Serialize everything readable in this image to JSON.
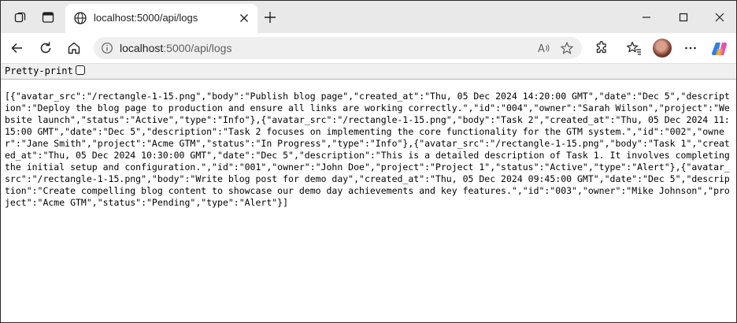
{
  "tab": {
    "title": "localhost:5000/api/logs"
  },
  "omnibox": {
    "host": "localhost",
    "path": ":5000/api/logs"
  },
  "icons": {
    "workspaces": "workspaces-icon",
    "tab_actions": "tab-actions-icon",
    "favicon": "globe-icon",
    "tab_close": "close-icon",
    "new_tab": "plus-icon",
    "minimize": "minimize-icon",
    "maximize": "maximize-icon",
    "window_close": "close-icon",
    "back": "back-arrow-icon",
    "refresh": "refresh-icon",
    "home": "home-icon",
    "site_info": "info-icon",
    "read_aloud": "read-aloud-icon",
    "favorite": "star-icon",
    "extensions": "puzzle-icon",
    "favorites": "favorites-icon",
    "more": "more-icon",
    "copilot": "copilot-icon"
  },
  "colors": {
    "tabbar_bg": "#e9e9e9",
    "omnibox_bg": "#efefef",
    "pretty_print_bg": "#f0f0f0"
  },
  "pretty_print": {
    "label": "Pretty-print",
    "checked": false
  },
  "json_body": "[{\"avatar_src\":\"/rectangle-1-15.png\",\"body\":\"Publish blog page\",\"created_at\":\"Thu, 05 Dec 2024 14:20:00 GMT\",\"date\":\"Dec 5\",\"description\":\"Deploy the blog page to production and ensure all links are working correctly.\",\"id\":\"004\",\"owner\":\"Sarah Wilson\",\"project\":\"Website launch\",\"status\":\"Active\",\"type\":\"Info\"},{\"avatar_src\":\"/rectangle-1-15.png\",\"body\":\"Task 2\",\"created_at\":\"Thu, 05 Dec 2024 11:15:00 GMT\",\"date\":\"Dec 5\",\"description\":\"Task 2 focuses on implementing the core functionality for the GTM system.\",\"id\":\"002\",\"owner\":\"Jane Smith\",\"project\":\"Acme GTM\",\"status\":\"In Progress\",\"type\":\"Info\"},{\"avatar_src\":\"/rectangle-1-15.png\",\"body\":\"Task 1\",\"created_at\":\"Thu, 05 Dec 2024 10:30:00 GMT\",\"date\":\"Dec 5\",\"description\":\"This is a detailed description of Task 1. It involves completing the initial setup and configuration.\",\"id\":\"001\",\"owner\":\"John Doe\",\"project\":\"Project 1\",\"status\":\"Active\",\"type\":\"Alert\"},{\"avatar_src\":\"/rectangle-1-15.png\",\"body\":\"Write blog post for demo day\",\"created_at\":\"Thu, 05 Dec 2024 09:45:00 GMT\",\"date\":\"Dec 5\",\"description\":\"Create compelling blog content to showcase our demo day achievements and key features.\",\"id\":\"003\",\"owner\":\"Mike Johnson\",\"project\":\"Acme GTM\",\"status\":\"Pending\",\"type\":\"Alert\"}]"
}
